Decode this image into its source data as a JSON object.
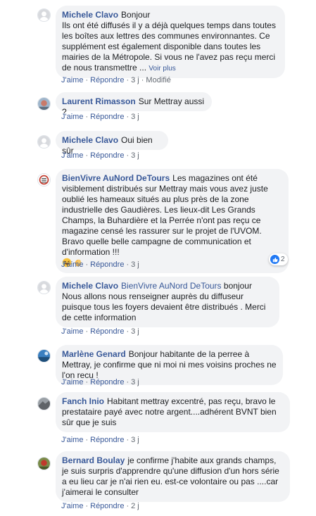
{
  "comments": [
    {
      "author": "Michele Clavo",
      "text": "Bonjour\nIls ont été diffusés il y a déjà quelques temps dans toutes les boîtes aux lettres des communes environnantes. Ce supplément est également disponible dans toutes les mairies de la Métropole. Si vous ne l'avez pas reçu merci de nous transmettre ... ",
      "see_more": "Voir plus",
      "like": "J'aime",
      "reply": "Répondre",
      "time": "3 j",
      "edited": "Modifié"
    },
    {
      "author": "Laurent Rimasson",
      "text": "Sur Mettray aussi ?",
      "like": "J'aime",
      "reply": "Répondre",
      "time": "3 j"
    },
    {
      "author": "Michele Clavo",
      "text": "Oui bien sûr",
      "like": "J'aime",
      "reply": "Répondre",
      "time": "3 j"
    },
    {
      "author": "BienVivre AuNord DeTours",
      "text": "Les magazines ont été visiblement distribués sur Mettray mais vous avez juste oublié les hameaux situés au plus près de la zone industrielle des Gaudières. Les lieux-dit Les Grands Champs, la Buhardière et la Perrée n'ont pas reçu ce magazine censé les rassurer sur le projet de l'UVOM. Bravo quelle belle campagne de communication et d'information !!!",
      "emojis": [
        "rofl-emoji",
        "clap-emoji"
      ],
      "like": "J'aime",
      "reply": "Répondre",
      "time": "3 j",
      "reaction_count": "2"
    },
    {
      "author": "Michele Clavo",
      "mention": "BienVivre AuNord DeTours",
      "text": "bonjour\nNous allons nous renseigner auprès du diffuseur puisque tous les foyers devaient être distribués . Merci de cette information",
      "like": "J'aime",
      "reply": "Répondre",
      "time": "3 j"
    },
    {
      "author": "Marlène Genard",
      "text": "Bonjour habitante de la perree à Mettray, je confirme que ni moi ni mes voisins proches ne l'on recu !",
      "like": "J'aime",
      "reply": "Répondre",
      "time": "3 j"
    },
    {
      "author": "Fanch Inio",
      "text": "Habitant mettray excentré, pas reçu, bravo le prestataire payé avec notre argent....adhérent BVNT bien sûr que je suis",
      "like": "J'aime",
      "reply": "Répondre",
      "time": "3 j"
    },
    {
      "author": "Bernard Boulay",
      "text": "je confirme j'habite aux grands champs, je suis surpris d'apprendre qu'une diffusion d'un hors série a eu lieu car je n'ai rien eu. est-ce volontaire ou pas ....car j'aimerai le consulter",
      "like": "J'aime",
      "reply": "Répondre",
      "time": "2 j"
    }
  ],
  "colors": {
    "link": "#385898",
    "bubble": "#f2f3f5",
    "meta": "#606770",
    "like_badge": "#2078f4"
  }
}
